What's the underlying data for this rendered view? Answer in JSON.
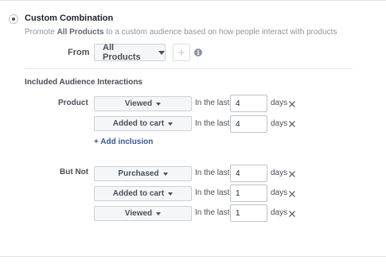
{
  "option": {
    "title": "Custom Combination",
    "desc_prefix": "Promote ",
    "desc_bold": "All Products",
    "desc_suffix": " to a custom audience based on how people interact with products"
  },
  "from": {
    "label": "From",
    "select_value": "All Products",
    "add_symbol": "+",
    "info_symbol": "i"
  },
  "included": {
    "section_title": "Included Audience Interactions",
    "label": "Product",
    "rows": [
      {
        "event": "Viewed",
        "in_the_last": "In the last",
        "value": "4",
        "unit": "days"
      },
      {
        "event": "Added to cart",
        "in_the_last": "In the last",
        "value": "4",
        "unit": "days"
      }
    ],
    "add_link": "+ Add inclusion"
  },
  "excluded": {
    "label": "But Not",
    "rows": [
      {
        "event": "Purchased",
        "in_the_last": "In the last",
        "value": "4",
        "unit": "days"
      },
      {
        "event": "Added to cart",
        "in_the_last": "In the last",
        "value": "1",
        "unit": "days"
      },
      {
        "event": "Viewed",
        "in_the_last": "In the last",
        "value": "1",
        "unit": "days"
      }
    ]
  },
  "icons": {
    "radio": "radio-selected-icon",
    "caret": "caret-down-icon",
    "remove": "close-icon",
    "info": "info-icon"
  },
  "colors": {
    "link": "#365899",
    "muted_text": "#90949c",
    "border": "#ccd0d5"
  }
}
